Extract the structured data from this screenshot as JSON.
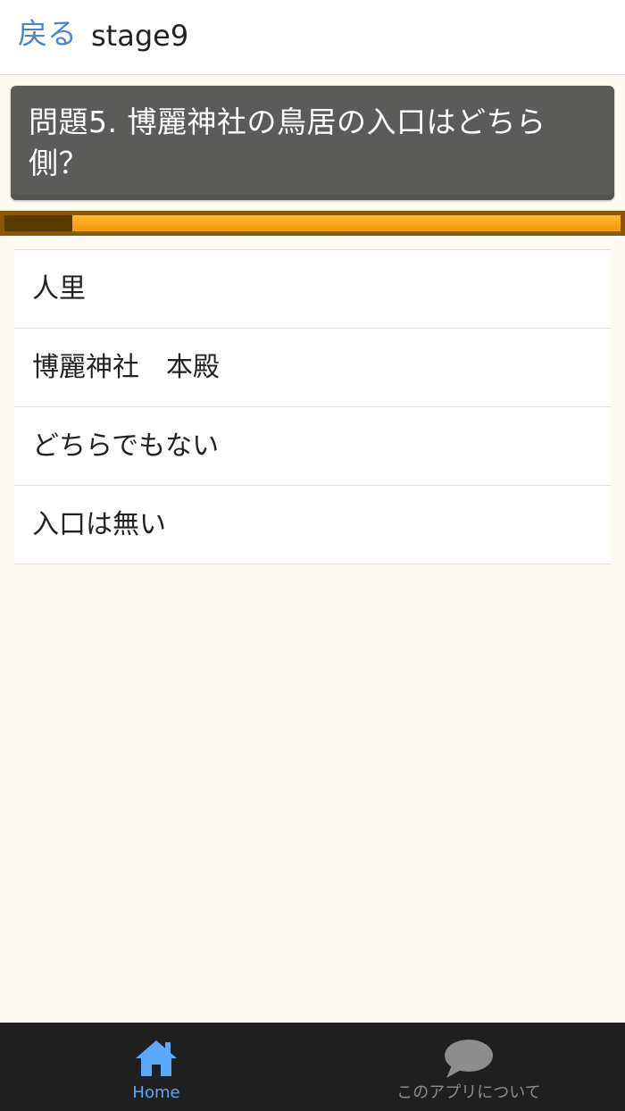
{
  "header": {
    "back_label": "戻る",
    "title": "stage9"
  },
  "question": {
    "text": "問題5. 博麗神社の鳥居の入口はどちら側？"
  },
  "progress": {
    "fraction": 0.11
  },
  "answers": [
    {
      "label": "人里"
    },
    {
      "label": "博麗神社　本殿"
    },
    {
      "label": "どちらでもない"
    },
    {
      "label": "入口は無い"
    }
  ],
  "tabbar": {
    "home_label": "Home",
    "about_label": "このアプリについて"
  },
  "colors": {
    "accent_blue": "#4a86c8",
    "tab_active": "#5aa9ff",
    "progress_orange": "#f39a00"
  }
}
